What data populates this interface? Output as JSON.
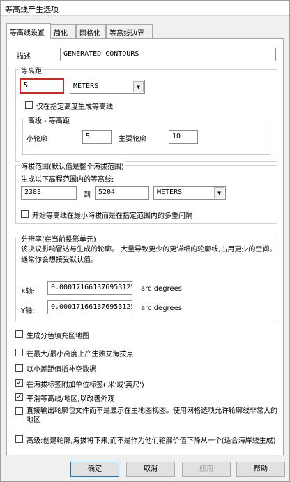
{
  "window": {
    "title": "等高线产生选项"
  },
  "tabs": [
    {
      "label": "等高线设置"
    },
    {
      "label": "简化"
    },
    {
      "label": "网格化"
    },
    {
      "label": "等高线边界"
    }
  ],
  "description": {
    "label": "描述",
    "value": "GENERATED CONTOURS"
  },
  "interval": {
    "group_label": "等高距",
    "value": "5",
    "unit": "METERS",
    "only_at_height_label": "仅在指定高度生成等高线",
    "advanced": {
      "group_label": "高级 - 等高距",
      "minor_label": "小轮廓",
      "minor_value": "5",
      "major_label": "主要轮廓",
      "major_value": "10"
    }
  },
  "elevation_range": {
    "group_label": "海拔范围(默认值是整个海拔范围)",
    "generate_label": "生成以下高程范围内的等高线:",
    "min_value": "2383",
    "to_label": "到",
    "max_value": "5204",
    "unit": "METERS",
    "start_multiple_label": "开始等高线在最小海拔而是在指定范围内的多重间隔"
  },
  "resolution": {
    "group_label": "分辨率(在当前投影单元)",
    "description": "该决议影响冒达与生成的轮廓。 大量导致更少的更详细的轮廓线,占用更少的空间。通常你会想接受默认值。",
    "x_label": "X轴:",
    "x_value": "0.000171661376953125",
    "y_label": "Y轴:",
    "y_value": "0.000171661376953125",
    "unit_label": "arc degrees"
  },
  "options": [
    {
      "label": "生成分色填充区地图",
      "checked": false
    },
    {
      "label": "在最大/最小高度上产生独立海拔点",
      "checked": false
    },
    {
      "label": "以小差距值插补空数据",
      "checked": false
    },
    {
      "label": "在海拔标签附加单位标签('米'或'英尺')",
      "checked": true
    },
    {
      "label": "平滑等高线/地区,以改善外观",
      "checked": true
    },
    {
      "label": "直接输出轮廓包文件而不是显示在主地图视图。使用网格选项允许轮廓线非常大的地区",
      "checked": false
    },
    {
      "label": "高级:创建轮廓,海拔将下来,而不是作为他们轮廓价值下降从一个(适合海岸线生成)",
      "checked": false
    }
  ],
  "buttons": {
    "ok": "确定",
    "cancel": "取消",
    "apply": "应用",
    "help": "帮助"
  }
}
